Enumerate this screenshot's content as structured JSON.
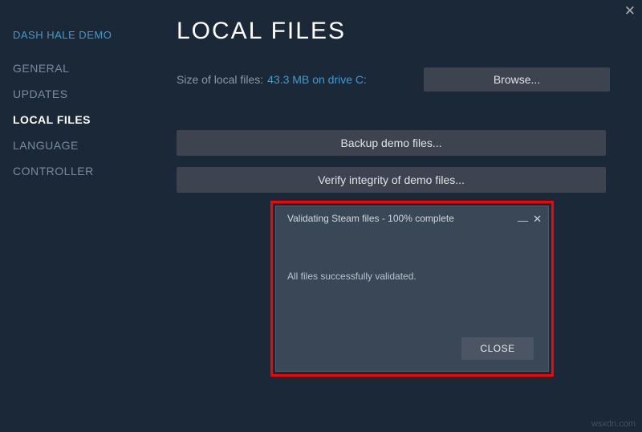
{
  "window": {
    "close_glyph": "✕"
  },
  "sidebar": {
    "game_title": "DASH HALE DEMO",
    "items": [
      {
        "label": "GENERAL"
      },
      {
        "label": "UPDATES"
      },
      {
        "label": "LOCAL FILES"
      },
      {
        "label": "LANGUAGE"
      },
      {
        "label": "CONTROLLER"
      }
    ],
    "active_index": 2
  },
  "main": {
    "title": "LOCAL FILES",
    "size_label": "Size of local files:",
    "size_value": "43.3 MB on drive C:",
    "browse_label": "Browse...",
    "backup_label": "Backup demo files...",
    "verify_label": "Verify integrity of demo files..."
  },
  "dialog": {
    "title": "Validating Steam files - 100% complete",
    "min_glyph": "—",
    "close_glyph": "✕",
    "message": "All files successfully validated.",
    "close_label": "CLOSE"
  },
  "watermark": "wsxdn.com"
}
